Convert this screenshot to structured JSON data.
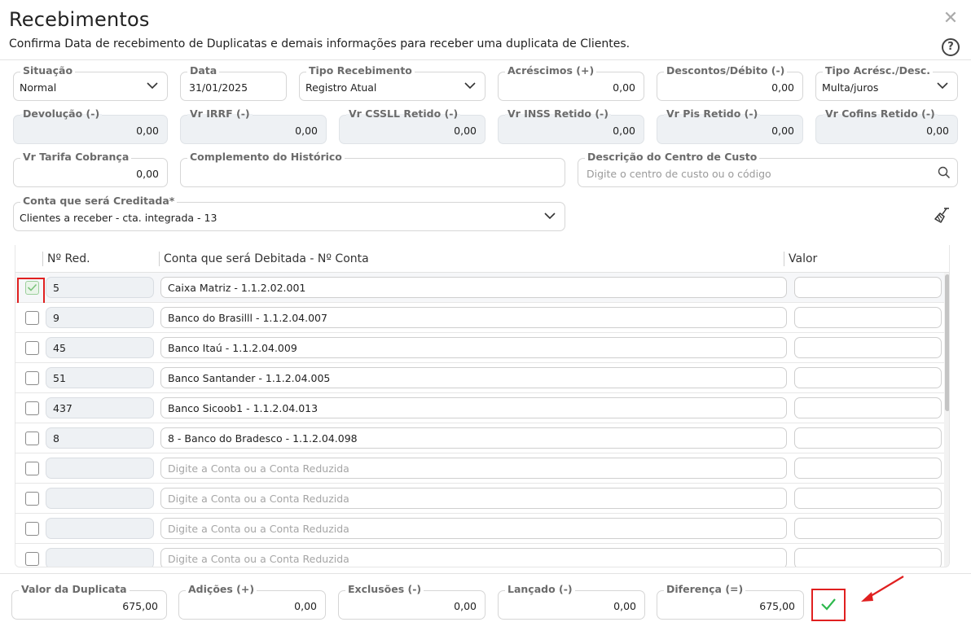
{
  "header": {
    "title": "Recebimentos",
    "subtitle": "Confirma Data de recebimento de Duplicatas e demais informações para receber uma duplicata de Clientes.",
    "close_label": "✕",
    "help_label": "?"
  },
  "fields": {
    "situacao": {
      "label": "Situação",
      "value": "Normal"
    },
    "data": {
      "label": "Data",
      "value": "31/01/2025"
    },
    "tipo_recebimento": {
      "label": "Tipo Recebimento",
      "value": "Registro Atual"
    },
    "acrescimos": {
      "label": "Acréscimos (+)",
      "value": "0,00"
    },
    "descontos": {
      "label": "Descontos/Débito (-)",
      "value": "0,00"
    },
    "tipo_acresc": {
      "label": "Tipo Acrésc./Desc.",
      "value": "Multa/juros"
    },
    "devolucao": {
      "label": "Devolução (-)",
      "value": "0,00"
    },
    "vr_irrf": {
      "label": "Vr IRRF (-)",
      "value": "0,00"
    },
    "vr_csll": {
      "label": "Vr CSSLL Retido (-)",
      "value": "0,00"
    },
    "vr_inss": {
      "label": "Vr INSS Retido (-)",
      "value": "0,00"
    },
    "vr_pis": {
      "label": "Vr Pis Retido (-)",
      "value": "0,00"
    },
    "vr_cofins": {
      "label": "Vr Cofins Retido (-)",
      "value": "0,00"
    },
    "vr_tarifa": {
      "label": "Vr Tarifa Cobrança",
      "value": "0,00"
    },
    "complemento": {
      "label": "Complemento do Histórico",
      "value": ""
    },
    "centro_custo": {
      "label": "Descrição do Centro de Custo",
      "placeholder": "Digite o centro de custo ou o código"
    },
    "conta_creditada": {
      "label": "Conta que será Creditada*",
      "value": "Clientes a receber - cta. integrada - 13"
    }
  },
  "grid": {
    "headers": {
      "nred": "Nº Red.",
      "conta": "Conta que será Debitada - Nº Conta",
      "valor": "Valor"
    },
    "placeholder": "Digite a Conta ou a Conta Reduzida",
    "rows": [
      {
        "nred": "5",
        "conta": "Caixa Matriz  - 1.1.2.02.001",
        "checked": true
      },
      {
        "nred": "9",
        "conta": "Banco do Brasilll - 1.1.2.04.007",
        "checked": false
      },
      {
        "nred": "45",
        "conta": "Banco Itaú - 1.1.2.04.009",
        "checked": false
      },
      {
        "nred": "51",
        "conta": "Banco Santander - 1.1.2.04.005",
        "checked": false
      },
      {
        "nred": "437",
        "conta": "Banco Sicoob1 - 1.1.2.04.013",
        "checked": false
      },
      {
        "nred": "8",
        "conta": "8 - Banco do Bradesco - 1.1.2.04.098",
        "checked": false
      }
    ],
    "empty_rows": 4
  },
  "totals": {
    "valor_duplicata": {
      "label": "Valor da Duplicata",
      "value": "675,00"
    },
    "adicoes": {
      "label": "Adições (+)",
      "value": "0,00"
    },
    "exclusoes": {
      "label": "Exclusões (-)",
      "value": "0,00"
    },
    "lancado": {
      "label": "Lançado (-)",
      "value": "0,00"
    },
    "diferenca": {
      "label": "Diferença (=)",
      "value": "675,00"
    }
  },
  "icons": {
    "close": "close-icon",
    "help": "help-icon",
    "chevron": "chevron-down-icon",
    "search": "search-icon",
    "broom": "broom-icon",
    "check": "check-icon"
  },
  "colors": {
    "highlight": "#e02020",
    "check_green": "#2db84d"
  }
}
